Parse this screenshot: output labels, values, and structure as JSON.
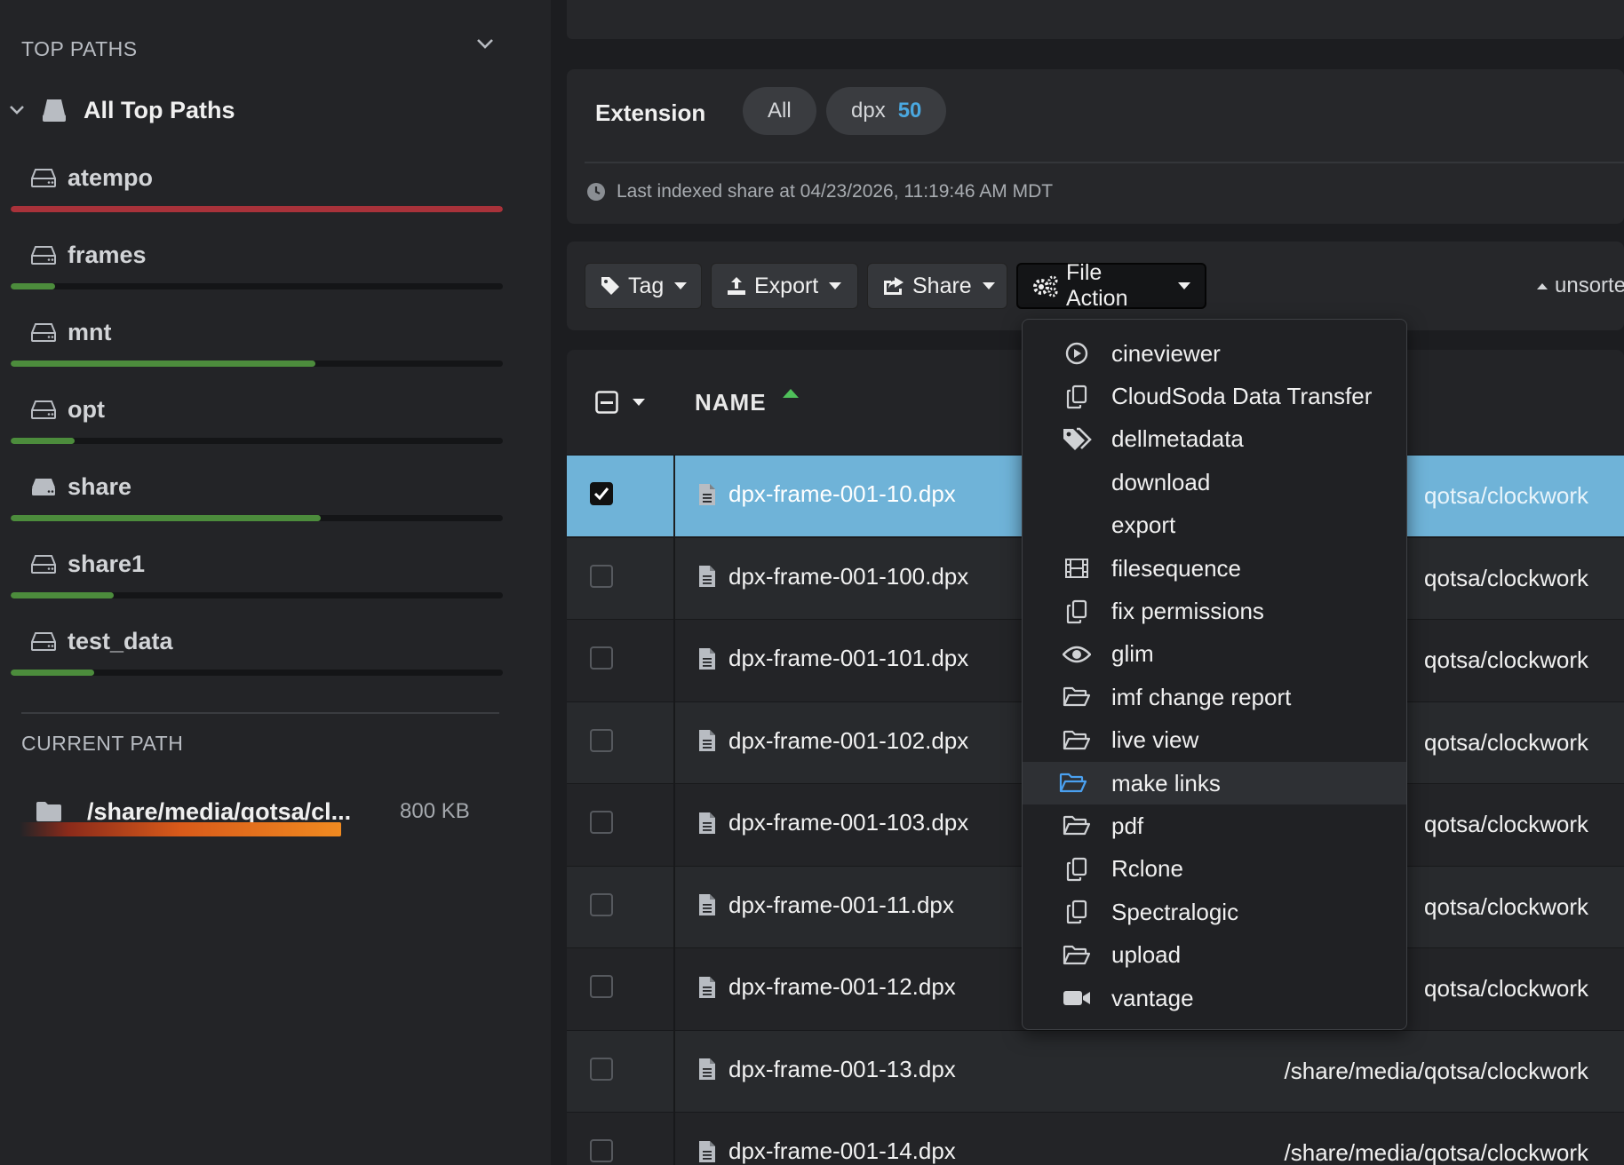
{
  "sidebar": {
    "top_paths_heading": "TOP PATHS",
    "all_top_paths": "All Top Paths",
    "paths": [
      {
        "name": "atempo",
        "usage": 1.0,
        "color": "#a8323a"
      },
      {
        "name": "frames",
        "usage": 0.09,
        "color": "#4c8c3c"
      },
      {
        "name": "mnt",
        "usage": 0.62,
        "color": "#4c8c3c"
      },
      {
        "name": "opt",
        "usage": 0.13,
        "color": "#4c8c3c"
      },
      {
        "name": "share",
        "usage": 0.63,
        "color": "#4c8c3c"
      },
      {
        "name": "share1",
        "usage": 0.21,
        "color": "#4c8c3c"
      },
      {
        "name": "test_data",
        "usage": 0.17,
        "color": "#4c8c3c"
      }
    ],
    "current_path_heading": "CURRENT PATH",
    "current_path": "/share/media/qotsa/cl...",
    "current_path_size": "800 KB"
  },
  "filters": {
    "extension_label": "Extension",
    "all_label": "All",
    "dpx_label": "dpx",
    "dpx_count": "50",
    "last_indexed": "Last indexed share at 04/23/2026, 11:19:46 AM MDT"
  },
  "toolbar": {
    "tag": "Tag",
    "export": "Export",
    "share": "Share",
    "file_action": "File Action",
    "sort": "unsorted"
  },
  "table": {
    "name_header": "NAME",
    "rows": [
      {
        "name": "dpx-frame-001-10.dpx",
        "path": "qotsa/clockwork",
        "selected": true
      },
      {
        "name": "dpx-frame-001-100.dpx",
        "path": "qotsa/clockwork"
      },
      {
        "name": "dpx-frame-001-101.dpx",
        "path": "qotsa/clockwork"
      },
      {
        "name": "dpx-frame-001-102.dpx",
        "path": "qotsa/clockwork"
      },
      {
        "name": "dpx-frame-001-103.dpx",
        "path": "qotsa/clockwork"
      },
      {
        "name": "dpx-frame-001-11.dpx",
        "path": "qotsa/clockwork"
      },
      {
        "name": "dpx-frame-001-12.dpx",
        "path": "qotsa/clockwork"
      },
      {
        "name": "dpx-frame-001-13.dpx",
        "path": "/share/media/qotsa/clockwork"
      },
      {
        "name": "dpx-frame-001-14.dpx",
        "path": "/share/media/qotsa/clockwork"
      }
    ]
  },
  "file_action_menu": {
    "items": [
      {
        "label": "cineviewer",
        "icon": "play-circle-icon"
      },
      {
        "label": "CloudSoda Data Transfer",
        "icon": "copy-icon"
      },
      {
        "label": "dellmetadata",
        "icon": "tags-icon"
      },
      {
        "label": "download",
        "icon": ""
      },
      {
        "label": "export",
        "icon": ""
      },
      {
        "label": "filesequence",
        "icon": "film-icon"
      },
      {
        "label": "fix permissions",
        "icon": "copy-icon"
      },
      {
        "label": "glim",
        "icon": "eye-icon"
      },
      {
        "label": "imf change report",
        "icon": "folder-open-icon"
      },
      {
        "label": "live view",
        "icon": "folder-open-icon"
      },
      {
        "label": "make links",
        "icon": "folder-open-icon",
        "highlighted": true
      },
      {
        "label": "pdf",
        "icon": "folder-open-icon"
      },
      {
        "label": "Rclone",
        "icon": "copy-icon"
      },
      {
        "label": "Spectralogic",
        "icon": "copy-icon"
      },
      {
        "label": "upload",
        "icon": "folder-open-icon"
      },
      {
        "label": "vantage",
        "icon": "video-camera-icon"
      }
    ]
  }
}
